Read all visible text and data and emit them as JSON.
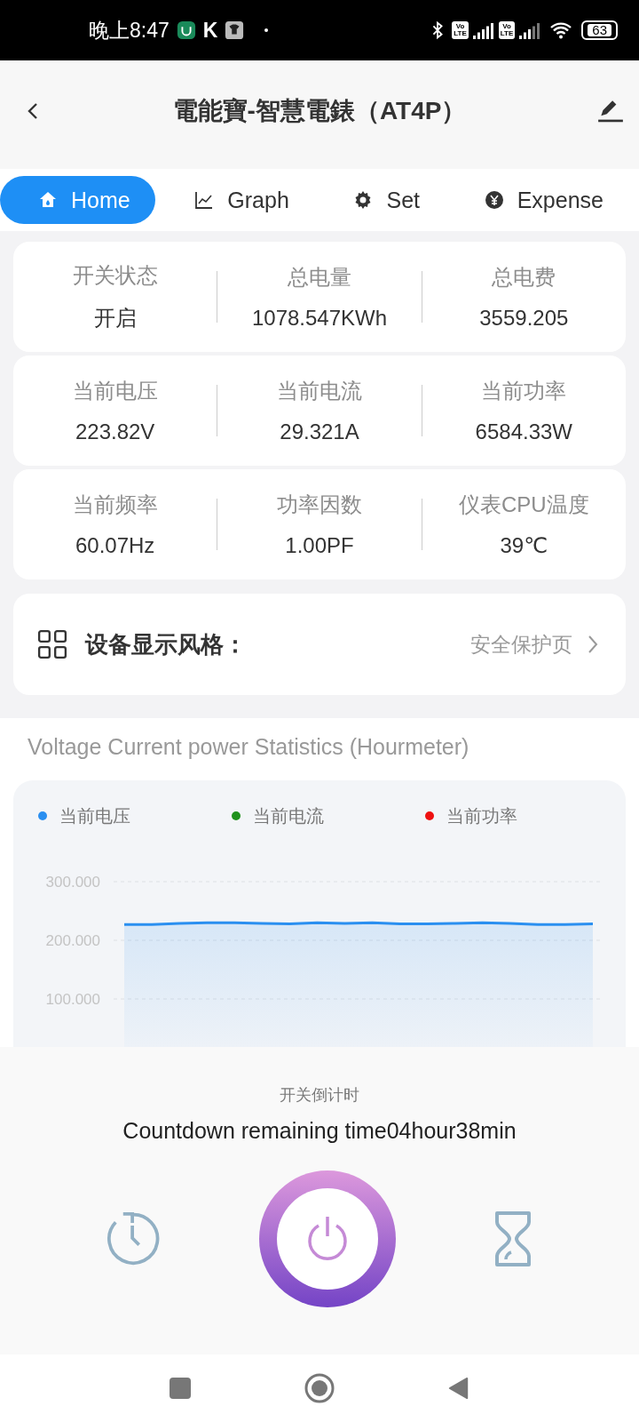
{
  "status_bar": {
    "time": "晚上8:47",
    "app_letter": "K",
    "volte": [
      {
        "top": "Vo",
        "bottom": "LTE"
      },
      {
        "top": "Vo",
        "bottom": "LTE"
      }
    ],
    "battery": "63"
  },
  "header": {
    "title": "電能寶-智慧電錶（AT4P）"
  },
  "tabs": [
    {
      "label": "Home",
      "selected": true
    },
    {
      "label": "Graph",
      "selected": false
    },
    {
      "label": "Set",
      "selected": false
    },
    {
      "label": "Expense",
      "selected": false
    }
  ],
  "stat_cards": [
    [
      {
        "label": "开关状态",
        "value": "开启"
      },
      {
        "label": "总电量",
        "value": "1078.547KWh"
      },
      {
        "label": "总电费",
        "value": "3559.205"
      }
    ],
    [
      {
        "label": "当前电压",
        "value": "223.82V"
      },
      {
        "label": "当前电流",
        "value": "29.321A"
      },
      {
        "label": "当前功率",
        "value": "6584.33W"
      }
    ],
    [
      {
        "label": "当前频率",
        "value": "60.07Hz"
      },
      {
        "label": "功率因数",
        "value": "1.00PF"
      },
      {
        "label": "仪表CPU温度",
        "value": "39℃"
      }
    ]
  ],
  "display_style": {
    "label": "设备显示风格：",
    "value": "安全保护页"
  },
  "chart_section": {
    "title": "Voltage Current power Statistics (Hourmeter)",
    "chart_data": {
      "type": "area",
      "ylim": [
        0,
        300
      ],
      "yticks": [
        {
          "value": 300,
          "label": "300.000"
        },
        {
          "value": 200,
          "label": "200.000"
        },
        {
          "value": 100,
          "label": "100.000"
        }
      ],
      "series": [
        {
          "name": "当前电压",
          "color": "#2a8ff0",
          "values": [
            227,
            227,
            229,
            230,
            230,
            229,
            228,
            230,
            229,
            230,
            228,
            228,
            229,
            230,
            229,
            227,
            227,
            228
          ]
        },
        {
          "name": "当前电流",
          "color": "#20921d",
          "values": [
            null,
            null,
            null,
            null,
            null,
            null,
            null,
            null,
            null,
            null,
            null,
            null,
            null,
            null,
            null,
            null,
            null,
            null
          ]
        },
        {
          "name": "当前功率",
          "color": "#ee1111",
          "values": [
            null,
            null,
            null,
            null,
            null,
            null,
            null,
            null,
            null,
            null,
            null,
            null,
            null,
            null,
            null,
            null,
            null,
            null
          ]
        }
      ]
    }
  },
  "countdown": {
    "label": "开关倒计时",
    "text": "Countdown remaining time04hour38min"
  }
}
